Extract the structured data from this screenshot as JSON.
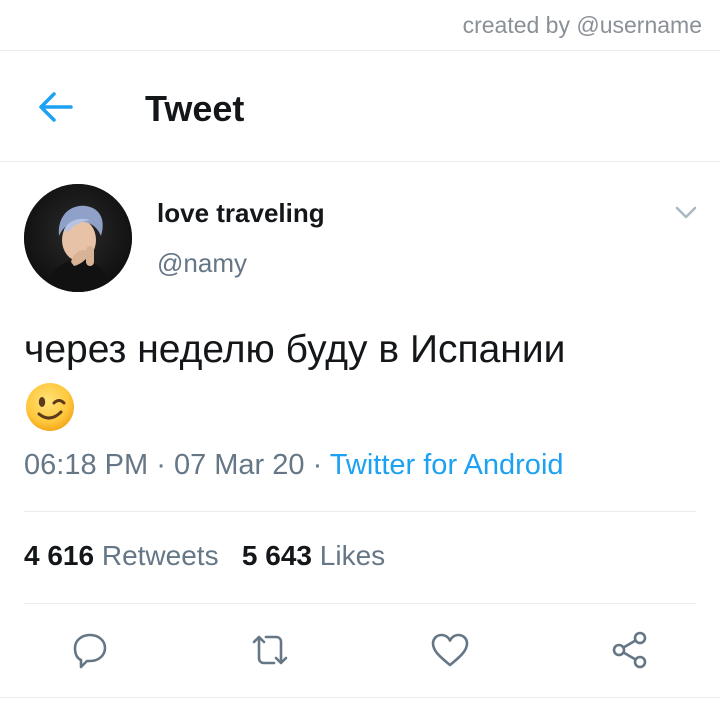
{
  "credit": "created by @username",
  "header": {
    "title": "Tweet",
    "back_icon": "arrow-left-icon"
  },
  "author": {
    "display_name": "love traveling",
    "handle": "@namy"
  },
  "tweet": {
    "text": "через неделю буду в Испании",
    "emoji": "winking-face",
    "time": "06:18 PM",
    "date": "07 Mar 20",
    "separator": "·",
    "source": "Twitter for Android"
  },
  "stats": {
    "retweets_count": "4 616",
    "retweets_label": "Retweets",
    "likes_count": "5 643",
    "likes_label": "Likes"
  },
  "actions": [
    "reply-icon",
    "retweet-icon",
    "like-icon",
    "share-icon"
  ],
  "colors": {
    "accent": "#1da1f2",
    "text": "#14171a",
    "secondary": "#657786",
    "border": "#e6ecf0",
    "icon": "#657786"
  }
}
